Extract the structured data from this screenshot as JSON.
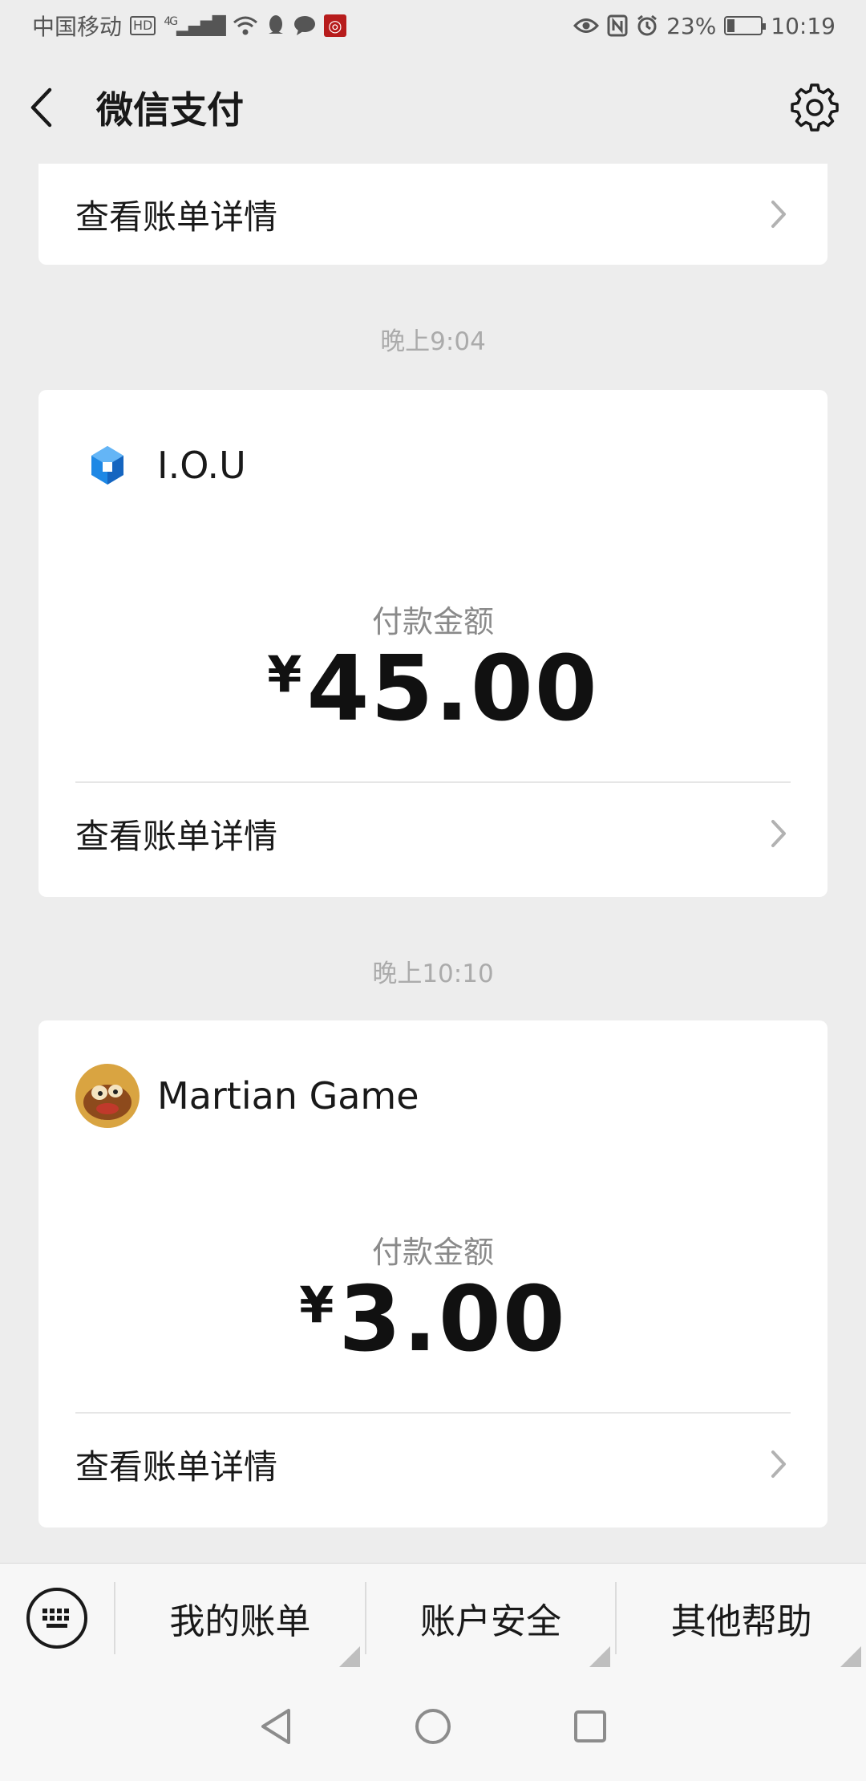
{
  "status_bar": {
    "carrier": "中国移动",
    "hd": "HD",
    "network": "4G",
    "battery": "23%",
    "battery_level": 0.23,
    "time": "10:19"
  },
  "header": {
    "title": "微信支付"
  },
  "top_card": {
    "detail_label": "查看账单详情"
  },
  "transactions": [
    {
      "time": "晚上9:04",
      "merchant": "I.O.U",
      "amount_label": "付款金额",
      "currency": "¥",
      "amount": "45.00",
      "detail_label": "查看账单详情"
    },
    {
      "time": "晚上10:10",
      "merchant": "Martian Game",
      "amount_label": "付款金额",
      "currency": "¥",
      "amount": "3.00",
      "detail_label": "查看账单详情"
    }
  ],
  "bottom_menu": {
    "items": [
      "我的账单",
      "账户安全",
      "其他帮助"
    ]
  },
  "colors": {
    "background": "#ededed",
    "card": "#ffffff",
    "text_primary": "#191919",
    "text_secondary": "#8a8a8a",
    "iou_icon": "#1e88e5"
  }
}
